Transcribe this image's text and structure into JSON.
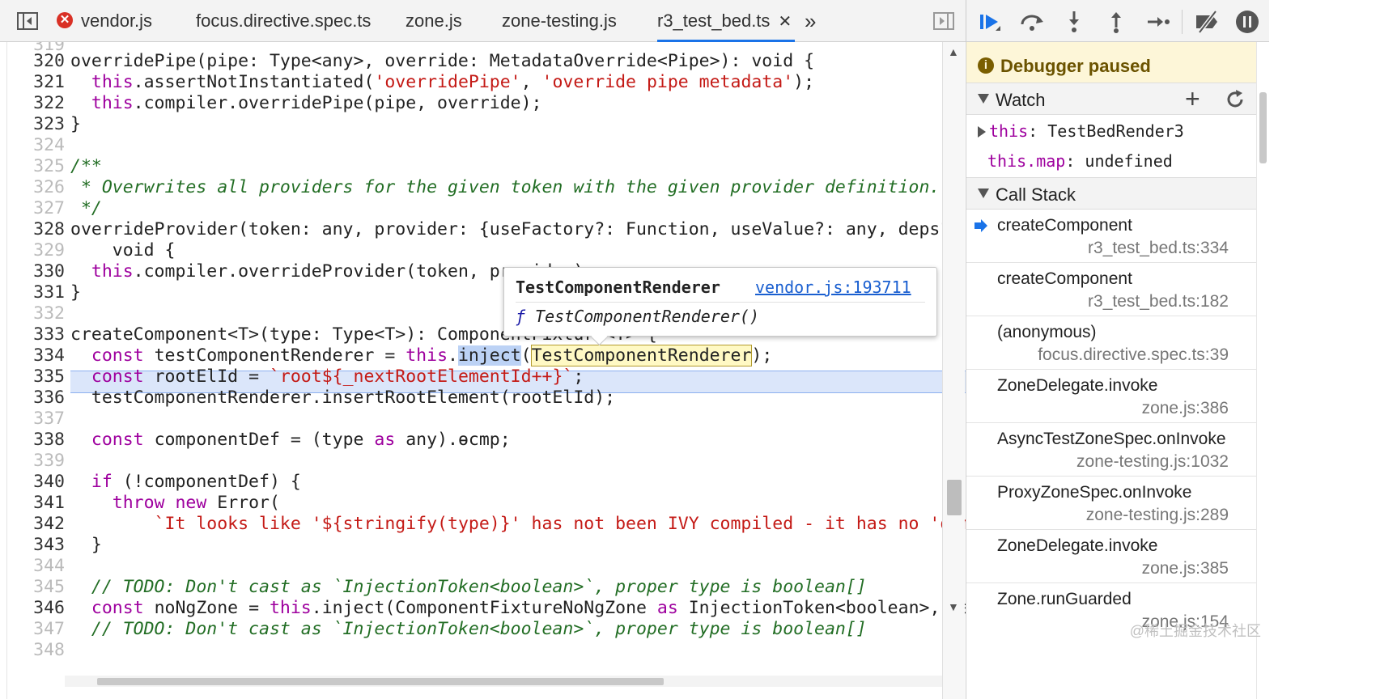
{
  "tabs": [
    {
      "label": "vendor.js",
      "error": true
    },
    {
      "label": "focus.directive.spec.ts"
    },
    {
      "label": "zone.js"
    },
    {
      "label": "zone-testing.js"
    },
    {
      "label": "r3_test_bed.ts",
      "active": true
    }
  ],
  "tab_error_glyph": "✕",
  "tab_close_glyph": "✕",
  "more_tabs_glyph": "»",
  "editor": {
    "line_numbers": [
      "319",
      "320",
      "321",
      "322",
      "323",
      "324",
      "325",
      "326",
      "327",
      "328",
      "329",
      "330",
      "331",
      "332",
      "333",
      "334",
      "335",
      "336",
      "337",
      "338",
      "339",
      "340",
      "341",
      "342",
      "343",
      "344",
      "345",
      "346",
      "347",
      "348"
    ],
    "current_line": "334",
    "lines": [
      "",
      "overridePipe(pipe: Type<any>, override: MetadataOverride<Pipe>): void {",
      "  this.assertNotInstantiated('overridePipe', 'override pipe metadata');",
      "  this.compiler.overridePipe(pipe, override);",
      "}",
      "",
      "/**",
      " * Overwrites all providers for the given token with the given provider definition.",
      " */",
      "overrideProvider(token: any, provider: {useFactory?: Function, useValue?: any, deps?: ar",
      "    void {",
      "  this.compiler.overrideProvider(token, provider);",
      "}",
      "",
      "createComponent<T>(type: Type<T>): ComponentFixture<T> {",
      "  const testComponentRenderer = this.inject(TestComponentRenderer);",
      "  const rootElId = `root${_nextRootElementId++}`;",
      "  testComponentRenderer.insertRootElement(rootElId);",
      "",
      "  const componentDef = (type as any).ɵcmp;",
      "",
      "  if (!componentDef) {",
      "    throw new Error(",
      "        `It looks like '${stringify(type)}' has not been IVY compiled - it has no 'ɵcmp'",
      "  }",
      "",
      "  // TODO: Don't cast as `InjectionToken<boolean>`, proper type is boolean[]",
      "  const noNgZone = this.inject(ComponentFixtureNoNgZone as InjectionToken<boolean>, fals",
      "  // TODO: Don't cast as `InjectionToken<boolean>`, proper type is boolean[]",
      ""
    ]
  },
  "popover": {
    "title": "TestComponentRenderer",
    "link": "vendor.js:193711",
    "fn_glyph": "ƒ",
    "signature": "TestComponentRenderer()"
  },
  "debugger": {
    "paused_text": "Debugger paused",
    "paused_icon": "i",
    "watch_title": "Watch",
    "watch_add": "+",
    "watch": [
      {
        "key": "this",
        "value": "TestBedRender3",
        "expandable": true
      },
      {
        "key": "this.map",
        "value": "undefined",
        "expandable": false
      }
    ],
    "callstack_title": "Call Stack",
    "callstack": [
      {
        "name": "createComponent",
        "loc": "r3_test_bed.ts:334",
        "current": true
      },
      {
        "name": "createComponent",
        "loc": "r3_test_bed.ts:182"
      },
      {
        "name": "(anonymous)",
        "loc": "focus.directive.spec.ts:39"
      },
      {
        "name": "ZoneDelegate.invoke",
        "loc": "zone.js:386"
      },
      {
        "name": "AsyncTestZoneSpec.onInvoke",
        "loc": "zone-testing.js:1032"
      },
      {
        "name": "ProxyZoneSpec.onInvoke",
        "loc": "zone-testing.js:289"
      },
      {
        "name": "ZoneDelegate.invoke",
        "loc": "zone.js:385"
      },
      {
        "name": "Zone.runGuarded",
        "loc": "zone.js:154"
      }
    ]
  },
  "watermark": "@稀土掘金技术社区",
  "colors": {
    "accent": "#1a73e8",
    "keyword": "#9e009e",
    "string": "#c41a16",
    "comment": "#236e25",
    "variable": "#1a1aa6",
    "paused_bg": "#fdf6d8"
  }
}
